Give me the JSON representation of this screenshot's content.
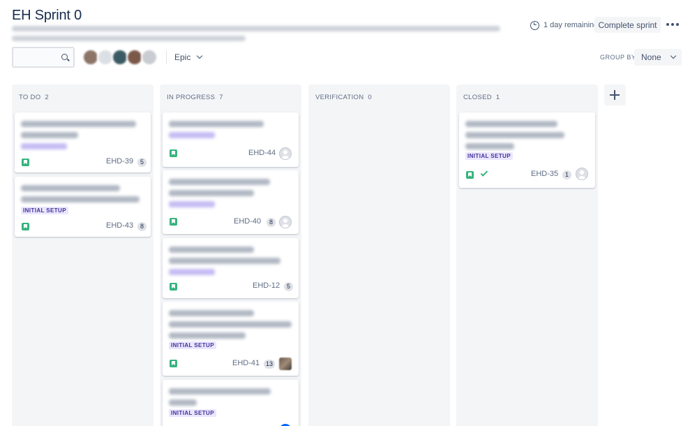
{
  "header": {
    "title": "EH Sprint 0",
    "remaining": "1 day remaining",
    "complete_label": "Complete sprint",
    "more_icon": "more-horizontal-icon"
  },
  "toolbar": {
    "search_placeholder": "",
    "epic_filter_label": "Epic",
    "group_by_label": "GROUP BY",
    "group_by_value": "None"
  },
  "colors": {
    "column_bg": "#f4f5f7",
    "story_icon": "#36b37e",
    "epic_lozenge_bg": "#eae6ff",
    "epic_lozenge_text": "#403294"
  },
  "columns": [
    {
      "name": "TO DO",
      "count": "2",
      "cards": [
        {
          "key": "EHD-39",
          "points": "5"
        },
        {
          "key": "EHD-43",
          "points": "8",
          "epic": "INITIAL SETUP"
        }
      ]
    },
    {
      "name": "IN PROGRESS",
      "count": "7",
      "cards": [
        {
          "key": "EHD-44"
        },
        {
          "key": "EHD-40",
          "points": "8"
        },
        {
          "key": "EHD-12",
          "points": "5"
        },
        {
          "key": "EHD-41",
          "points": "13",
          "epic": "INITIAL SETUP"
        },
        {
          "epic": "INITIAL SETUP"
        }
      ]
    },
    {
      "name": "VERIFICATION",
      "count": "0",
      "cards": []
    },
    {
      "name": "CLOSED",
      "count": "1",
      "cards": [
        {
          "key": "EHD-35",
          "points": "1",
          "epic": "INITIAL SETUP"
        }
      ]
    }
  ]
}
